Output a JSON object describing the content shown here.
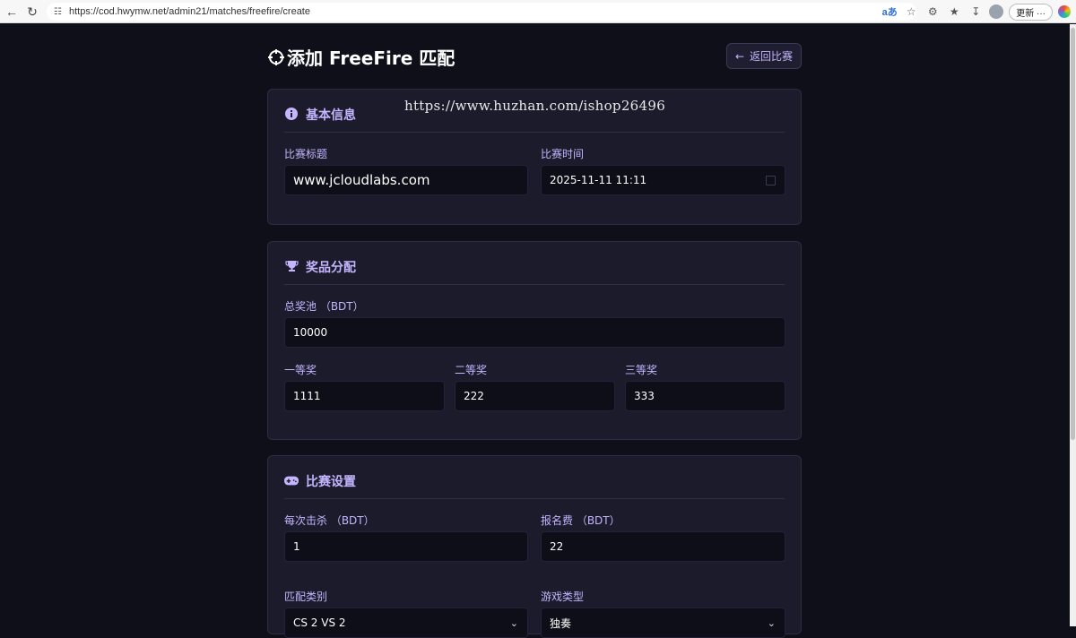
{
  "browser": {
    "url": "https://cod.hwymw.net/admin21/matches/freefire/create",
    "translate_label": "aあ",
    "update_label": "更新",
    "more_label": "···"
  },
  "page": {
    "title": "添加 FreeFire 匹配",
    "back_label": "返回比赛",
    "watermark": "https://www.huzhan.com/ishop26496"
  },
  "basic_info": {
    "heading": "基本信息",
    "title_label": "比赛标题",
    "title_value": "www.jcloudlabs.com",
    "time_label": "比赛时间",
    "time_value": "2025-11-11 11:11"
  },
  "prizes": {
    "heading": "奖品分配",
    "pool_label": "总奖池 （BDT）",
    "pool_value": "10000",
    "first_label": "一等奖",
    "first_value": "1111",
    "second_label": "二等奖",
    "second_value": "222",
    "third_label": "三等奖",
    "third_value": "333"
  },
  "settings": {
    "heading": "比赛设置",
    "kill_label": "每次击杀 （BDT）",
    "kill_value": "1",
    "fee_label": "报名费 （BDT）",
    "fee_value": "22",
    "match_type_label": "匹配类别",
    "match_type_value": "CS 2 VS 2",
    "game_type_label": "游戏类型",
    "game_type_value": "独奏"
  },
  "colors": {
    "background": "#0f0f1a",
    "card": "#1b1b2c",
    "accent": "#c4b5fd",
    "input": "#0e0e18"
  }
}
